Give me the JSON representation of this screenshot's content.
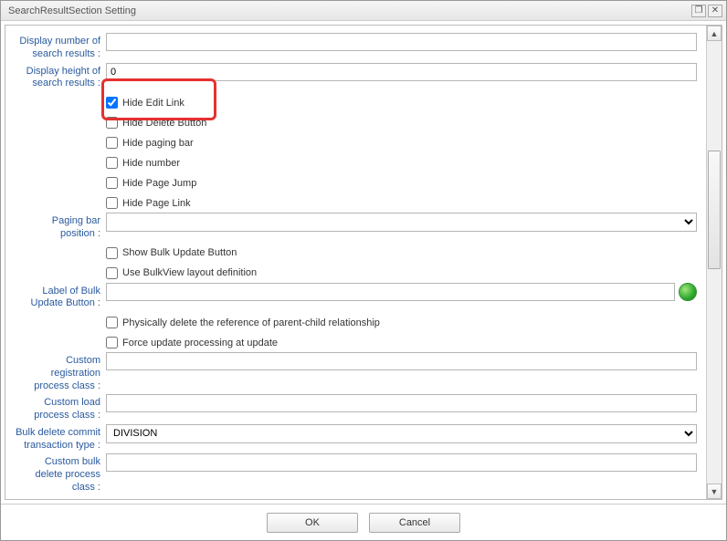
{
  "window": {
    "title": "SearchResultSection Setting",
    "maximize_icon": "❐",
    "close_icon": "✕"
  },
  "form": {
    "displayNumber": {
      "label": "Display number of search results :",
      "value": ""
    },
    "displayHeight": {
      "label": "Display height of search results :",
      "value": "0"
    },
    "cbHideEditLink": "Hide Edit Link",
    "cbHideDeleteButton": "Hide Delete Button",
    "cbHidePagingBar": "Hide paging bar",
    "cbHideNumber": "Hide number",
    "cbHidePageJump": "Hide Page Jump",
    "cbHidePageLink": "Hide Page Link",
    "pagingBarPos": {
      "label": "Paging bar position :",
      "value": ""
    },
    "cbShowBulkUpdate": "Show Bulk Update Button",
    "cbUseBulkView": "Use BulkView layout definition",
    "labelBulkUpdate": {
      "label": "Label of Bulk Update Button :",
      "value": ""
    },
    "cbPhysicallyDelete": "Physically delete the reference of parent-child relationship",
    "cbForceUpdate": "Force update processing at update",
    "customReg": {
      "label": "Custom registration process class :",
      "value": ""
    },
    "customLoad": {
      "label": "Custom load process class :",
      "value": ""
    },
    "bulkDeleteTxn": {
      "label": "Bulk delete commit transaction type :",
      "value": "DIVISION"
    },
    "customBulkDelete": {
      "label": "Custom bulk delete process class :",
      "value": ""
    }
  },
  "buttons": {
    "ok": "OK",
    "cancel": "Cancel"
  }
}
